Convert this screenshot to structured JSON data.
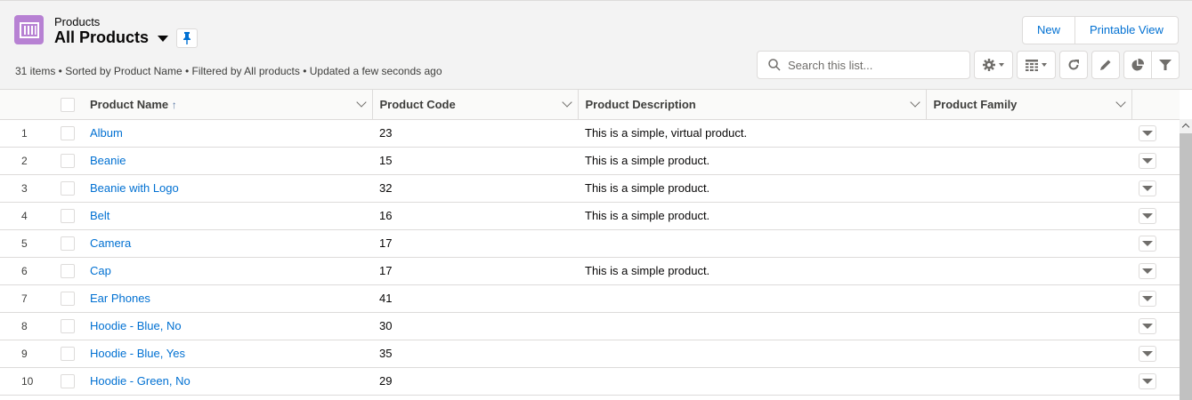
{
  "header": {
    "object_label": "Products",
    "list_title": "All Products",
    "meta": "31 items • Sorted by Product Name • Filtered by All products • Updated a few seconds ago",
    "app_color": "#b781d3"
  },
  "actions": {
    "new": "New",
    "printable": "Printable View"
  },
  "search": {
    "placeholder": "Search this list...",
    "value": ""
  },
  "toolbar": {
    "icons": [
      "gear-icon",
      "table-icon",
      "refresh-icon",
      "pencil-icon",
      "chart-icon",
      "filter-icon"
    ]
  },
  "columns": [
    {
      "label": "Product Name",
      "sorted": "ascending"
    },
    {
      "label": "Product Code"
    },
    {
      "label": "Product Description"
    },
    {
      "label": "Product Family"
    }
  ],
  "rows": [
    {
      "n": "1",
      "name": "Album",
      "code": "23",
      "desc": "This is a simple, virtual product.",
      "family": ""
    },
    {
      "n": "2",
      "name": "Beanie",
      "code": "15",
      "desc": "This is a simple product.",
      "family": ""
    },
    {
      "n": "3",
      "name": "Beanie with Logo",
      "code": "32",
      "desc": "This is a simple product.",
      "family": ""
    },
    {
      "n": "4",
      "name": "Belt",
      "code": "16",
      "desc": "This is a simple product.",
      "family": ""
    },
    {
      "n": "5",
      "name": "Camera",
      "code": "17",
      "desc": "",
      "family": ""
    },
    {
      "n": "6",
      "name": "Cap",
      "code": "17",
      "desc": "This is a simple product.",
      "family": ""
    },
    {
      "n": "7",
      "name": "Ear Phones",
      "code": "41",
      "desc": "",
      "family": ""
    },
    {
      "n": "8",
      "name": "Hoodie - Blue, No",
      "code": "30",
      "desc": "",
      "family": ""
    },
    {
      "n": "9",
      "name": "Hoodie - Blue, Yes",
      "code": "35",
      "desc": "",
      "family": ""
    },
    {
      "n": "10",
      "name": "Hoodie - Green, No",
      "code": "29",
      "desc": "",
      "family": ""
    }
  ]
}
